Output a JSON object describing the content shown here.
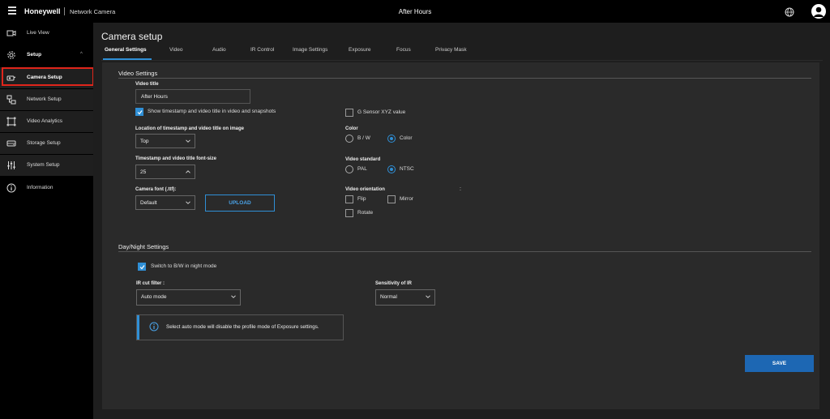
{
  "header": {
    "brand": "Honeywell",
    "product": "Network Camera",
    "title": "After Hours"
  },
  "sidebar": {
    "items": [
      {
        "label": "Live View",
        "icon": "live-view-icon"
      },
      {
        "label": "Setup",
        "icon": "gear-icon"
      },
      {
        "label": "Camera Setup",
        "icon": "camera-icon"
      },
      {
        "label": "Network Setup",
        "icon": "network-icon"
      },
      {
        "label": "Video Analytics",
        "icon": "analytics-icon"
      },
      {
        "label": "Storage Setup",
        "icon": "storage-icon"
      },
      {
        "label": "System Setup",
        "icon": "sliders-icon"
      },
      {
        "label": "Information",
        "icon": "info-icon"
      }
    ]
  },
  "page": {
    "title": "Camera setup",
    "tabs": [
      "General Settings",
      "Video",
      "Audio",
      "IR Control",
      "Image Settings",
      "Exposure",
      "Focus",
      "Privacy Mask"
    ]
  },
  "video_settings": {
    "section_title": "Video Settings",
    "video_title_label": "Video title",
    "video_title_value": "After Hours",
    "show_timestamp_label": "Show timestamp and video title in video and snapshots",
    "show_timestamp_checked": true,
    "location_label": "Location of timestamp and video title on image",
    "location_value": "Top",
    "font_size_label": "Timestamp and video title font-size",
    "font_size_value": "25",
    "camera_font_label": "Camera font (.ttf):",
    "camera_font_value": "Default",
    "upload_label": "UPLOAD",
    "g_sensor_label": "G Sensor XYZ value",
    "g_sensor_checked": false,
    "color_label": "Color",
    "color_options": [
      "B / W",
      "Color"
    ],
    "color_selected": "Color",
    "video_standard_label": "Video standard",
    "video_standard_options": [
      "PAL",
      "NTSC"
    ],
    "video_standard_selected": "NTSC",
    "video_orientation_label": "Video orientation",
    "orientation_colon": ":",
    "orientation_options": [
      "Flip",
      "Mirror",
      "Rotate"
    ]
  },
  "day_night": {
    "section_title": "Day/Night Settings",
    "switch_bw_label": "Switch to B/W in night mode",
    "switch_bw_checked": true,
    "ir_cut_label": "IR cut filter :",
    "ir_cut_value": "Auto mode",
    "sensitivity_label": "Sensitivity of IR",
    "sensitivity_value": "Normal",
    "info_message": "Select auto mode will disable the profile mode of Exposure settings."
  },
  "actions": {
    "save_label": "SAVE"
  },
  "colors": {
    "accent": "#2f8fd6",
    "highlight_red": "#e0251b",
    "save_bg": "#1d67b3"
  }
}
